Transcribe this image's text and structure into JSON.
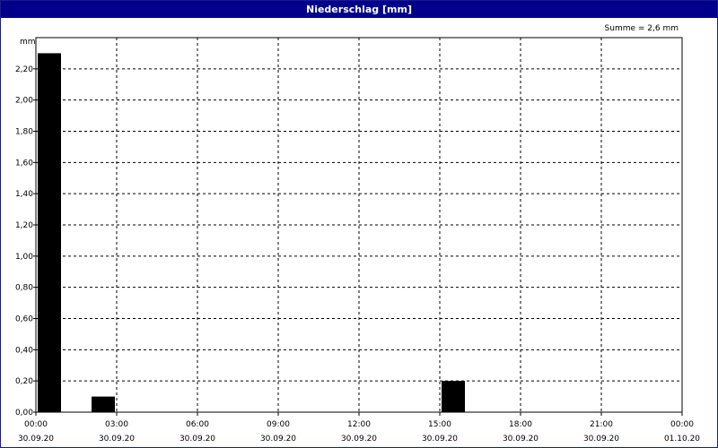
{
  "window": {
    "title": "Niederschlag [mm]"
  },
  "chart_data": {
    "type": "bar",
    "title": "Niederschlag [mm]",
    "annotation": "Summe = 2,6 mm",
    "ylabel": "mm",
    "ylim": [
      0,
      2.4
    ],
    "yticks": [
      "0,00",
      "0,20",
      "0,40",
      "0,60",
      "0,80",
      "1,00",
      "1,20",
      "1,40",
      "1,60",
      "1,80",
      "2,00",
      "2,20"
    ],
    "ytick_values": [
      0,
      0.2,
      0.4,
      0.6,
      0.8,
      1.0,
      1.2,
      1.4,
      1.6,
      1.8,
      2.0,
      2.2
    ],
    "xlim": [
      0,
      24
    ],
    "xticks": [
      {
        "time": "00:00",
        "date": "30.09.20",
        "hour": 0
      },
      {
        "time": "03:00",
        "date": "30.09.20",
        "hour": 3
      },
      {
        "time": "06:00",
        "date": "30.09.20",
        "hour": 6
      },
      {
        "time": "09:00",
        "date": "30.09.20",
        "hour": 9
      },
      {
        "time": "12:00",
        "date": "30.09.20",
        "hour": 12
      },
      {
        "time": "15:00",
        "date": "30.09.20",
        "hour": 15
      },
      {
        "time": "18:00",
        "date": "30.09.20",
        "hour": 18
      },
      {
        "time": "21:00",
        "date": "30.09.20",
        "hour": 21
      },
      {
        "time": "00:00",
        "date": "01.10.20",
        "hour": 24
      }
    ],
    "bars": [
      {
        "hour_start": 0,
        "hour_end": 1,
        "value": 2.3
      },
      {
        "hour_start": 2,
        "hour_end": 3,
        "value": 0.1
      },
      {
        "hour_start": 15,
        "hour_end": 16,
        "value": 0.2
      }
    ],
    "grid": true,
    "bar_color": "#000000"
  }
}
